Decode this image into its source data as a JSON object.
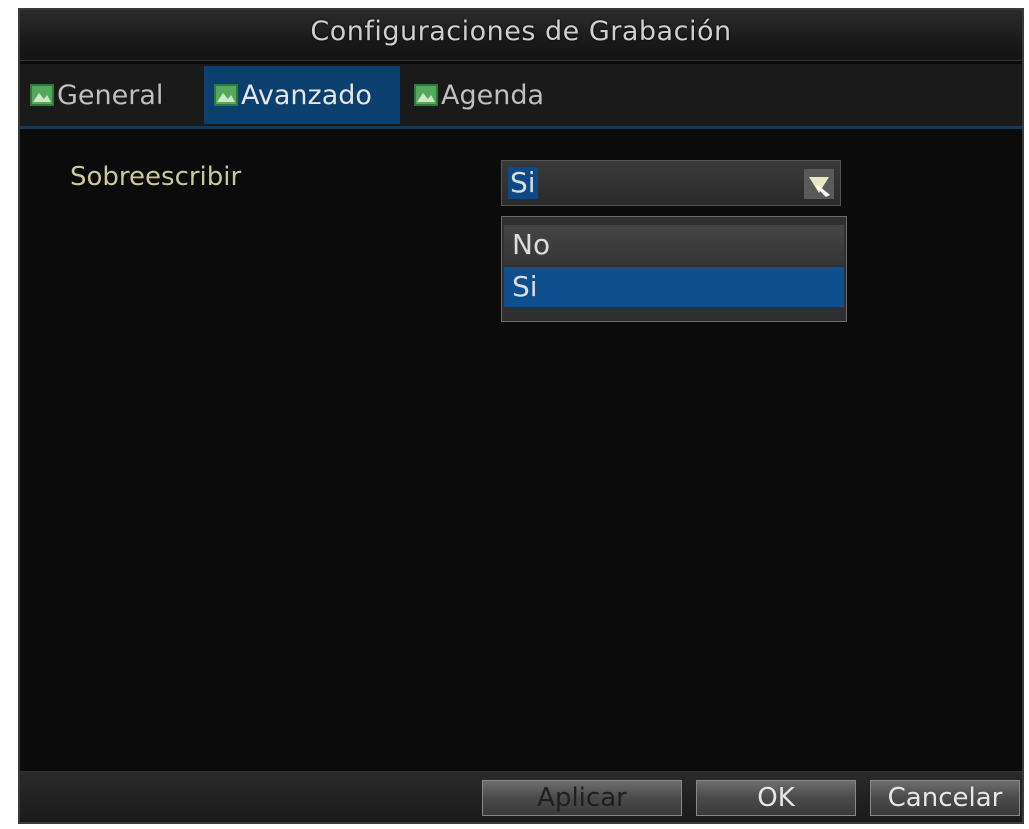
{
  "window": {
    "title": "Configuraciones de Grabación"
  },
  "tabs": [
    {
      "label": "General",
      "active": false,
      "icon": "picture-icon"
    },
    {
      "label": "Avanzado",
      "active": true,
      "icon": "picture-icon"
    },
    {
      "label": "Agenda",
      "active": false,
      "icon": "picture-icon"
    }
  ],
  "form": {
    "overwrite_label": "Sobreescribir",
    "overwrite_value": "Si",
    "options": [
      "No",
      "Si"
    ],
    "selected_option": "Si"
  },
  "footer": {
    "apply_label": "Aplicar",
    "ok_label": "OK",
    "cancel_label": "Cancelar"
  },
  "colors": {
    "accent_blue": "#0d4f8f",
    "background": "#0b0b0b",
    "label_color": "#c8c89a"
  }
}
